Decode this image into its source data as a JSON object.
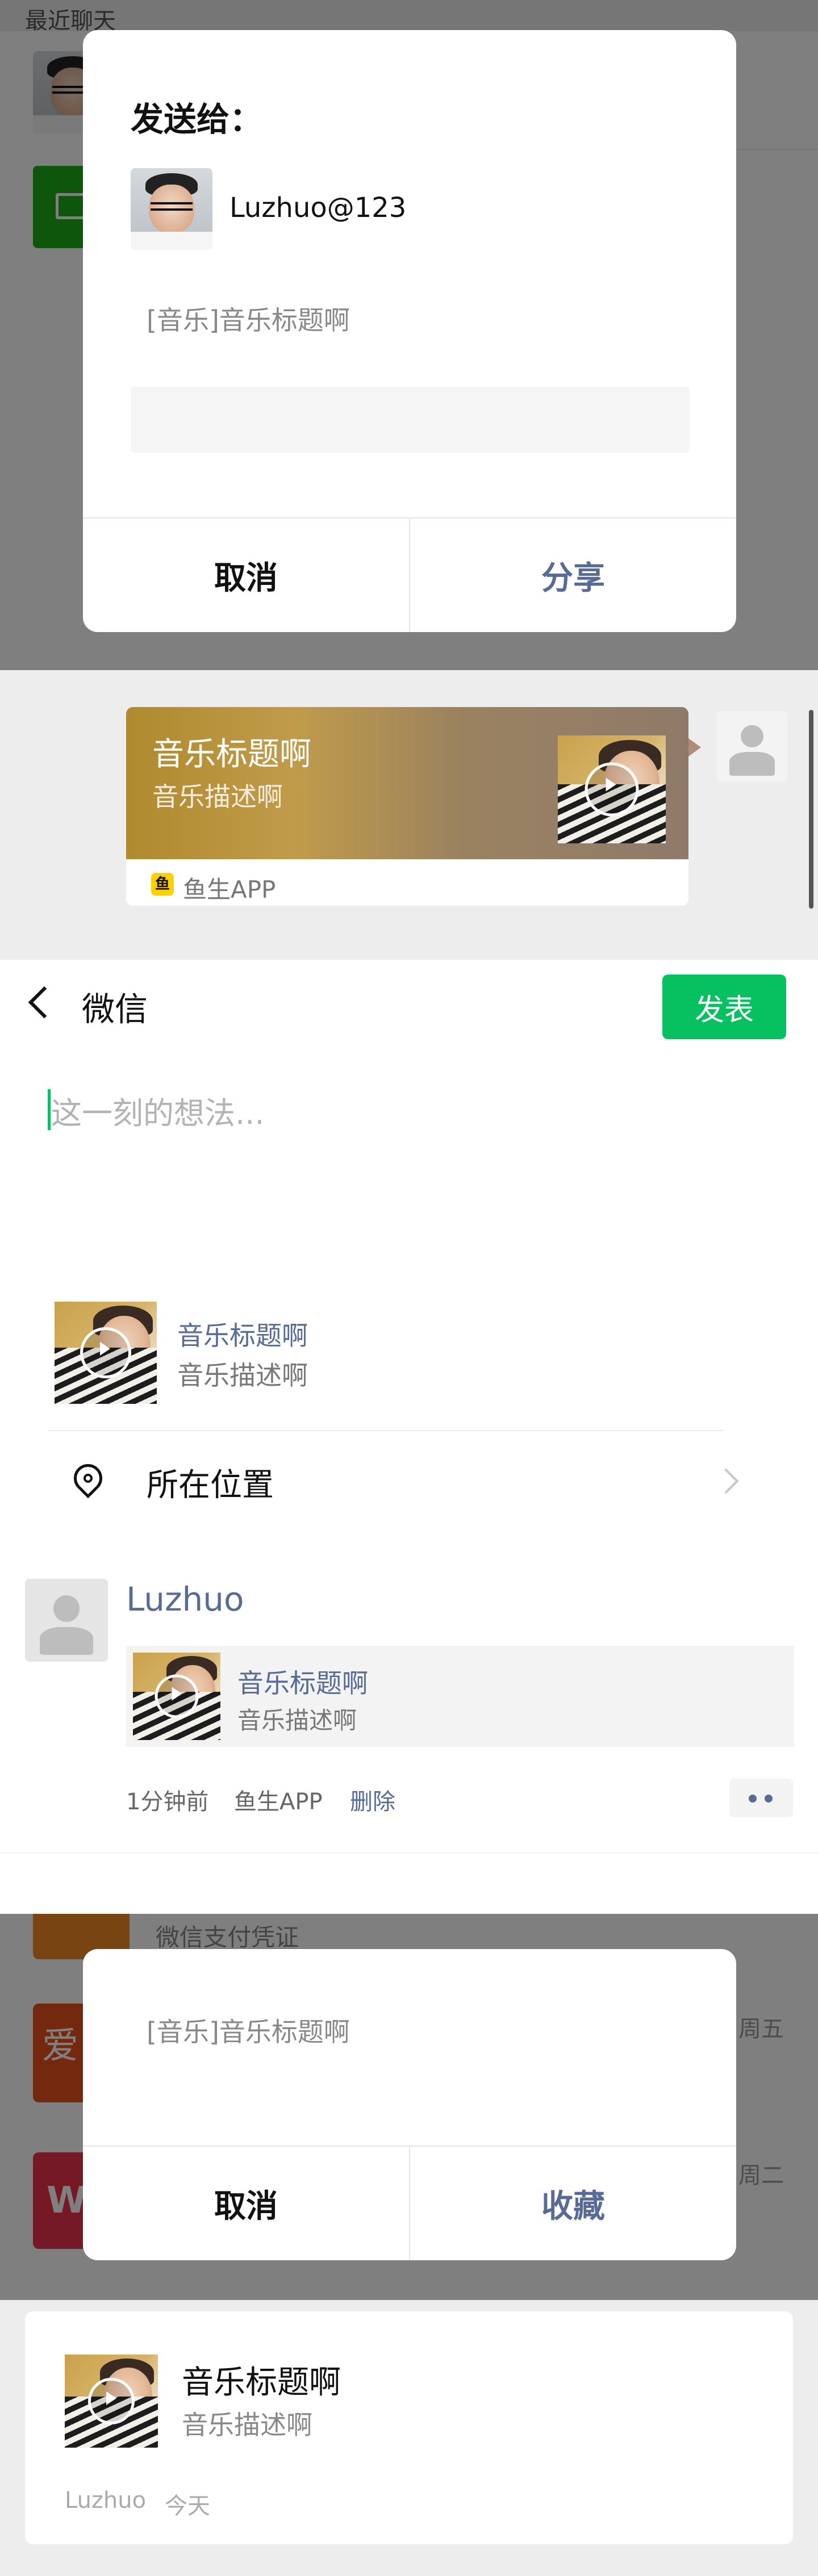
{
  "colors": {
    "wechat_green": "#07c160",
    "link_blue": "#576b95",
    "overlay_gray": "#7f7f7f"
  },
  "panel1": {
    "header_label": "最近聊天",
    "dialog": {
      "title": "发送给：",
      "recipient_name": "Luzhuo@123",
      "message_preview": "[音乐]音乐标题啊",
      "input_placeholder": "",
      "cancel_label": "取消",
      "confirm_label": "分享"
    }
  },
  "panel2": {
    "card": {
      "title": "音乐标题啊",
      "description": "音乐描述啊",
      "source_app": "鱼生APP",
      "app_icon": "fish-app-icon"
    }
  },
  "panel3": {
    "nav": {
      "back_icon": "chevron-left-icon",
      "title": "微信",
      "publish_label": "发表"
    },
    "compose_placeholder": "这一刻的想法...",
    "shared_item": {
      "title": "音乐标题啊",
      "description": "音乐描述啊"
    },
    "location": {
      "icon": "location-pin-icon",
      "label": "所在位置",
      "chevron": "chevron-right-icon"
    },
    "post": {
      "author": "Luzhuo",
      "item_title": "音乐标题啊",
      "item_description": "音乐描述啊",
      "time": "1分钟前",
      "source": "鱼生APP",
      "delete_label": "删除",
      "more_icon": "more-dots-icon"
    }
  },
  "panel4": {
    "background_rows": [
      {
        "preview": "微信支付凭证",
        "time": ""
      },
      {
        "preview": "",
        "time": "周五"
      },
      {
        "preview": "",
        "time": "周二"
      }
    ],
    "dialog": {
      "message_preview": "[音乐]音乐标题啊",
      "cancel_label": "取消",
      "confirm_label": "收藏"
    }
  },
  "panel5": {
    "fav": {
      "title": "音乐标题啊",
      "description": "音乐描述啊",
      "author": "Luzhuo",
      "time": "今天"
    }
  }
}
